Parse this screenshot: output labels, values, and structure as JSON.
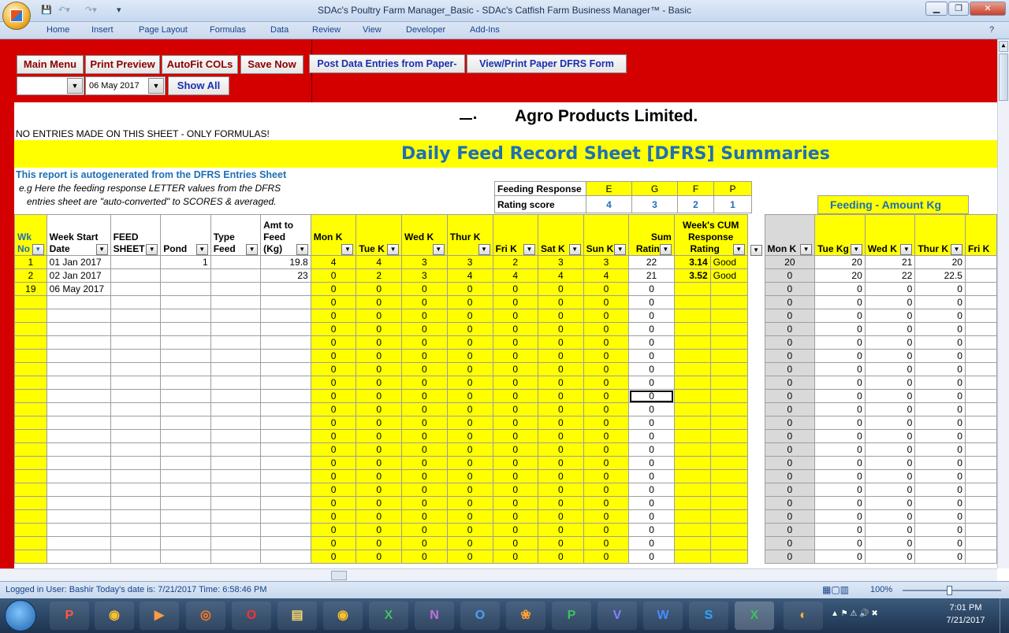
{
  "window": {
    "title": "SDAc's Poultry Farm Manager_Basic - SDAc's Catfish Farm Business Manager™ - Basic"
  },
  "ribbon_tabs": [
    "Home",
    "Insert",
    "Page Layout",
    "Formulas",
    "Data",
    "Review",
    "View",
    "Developer",
    "Add-Ins"
  ],
  "buttons": {
    "main_menu": "Main Menu",
    "print_preview": "Print Preview",
    "autofit": "AutoFit COLs",
    "save_now": "Save Now",
    "post_data": "Post Data Entries from Paper-",
    "view_print": "View/Print Paper DFRS Form",
    "show_all": "Show All"
  },
  "date_combo": {
    "value": "06 May 2017"
  },
  "company": "Agro Products Limited.",
  "notice": "NO ENTRIES MADE ON THIS SHEET - ONLY FORMULAS!",
  "sheet_title": "Daily Feed Record Sheet [DFRS] Summaries",
  "report_note": {
    "line1": "This report is autogenerated from the DFRS Entries Sheet",
    "line2": "e.g Here the feeding response LETTER values from the DFRS",
    "line3": "entries sheet are \"auto-converted\" to SCORES & averaged."
  },
  "response_legend": {
    "feeding_label": "Feeding Response",
    "rating_label": "Rating score",
    "letters": [
      "E",
      "G",
      "F",
      "P"
    ],
    "scores": [
      "4",
      "3",
      "2",
      "1"
    ]
  },
  "amount_title": "Feeding - Amount Kg",
  "headers": {
    "wk_no": [
      "Wk",
      "No"
    ],
    "week_start": [
      "Week Start",
      "Date"
    ],
    "feed_sheet": [
      "FEED",
      "SHEET"
    ],
    "pond": "Pond",
    "type_feed": [
      "Type",
      "Feed"
    ],
    "amt_feed": [
      "Amt to",
      "Feed",
      "(Kg)"
    ],
    "days": [
      "Mon K",
      "Tue K",
      "Wed K",
      "Thur K",
      "Fri K",
      "Sat K",
      "Sun K"
    ],
    "sum_rating": [
      "Sum",
      "Ratin"
    ],
    "cum": [
      "Week's CUM",
      "Response",
      "Rating"
    ],
    "amount_days": [
      "Mon K",
      "Tue Kg",
      "Wed K",
      "Thur K",
      "Fri K"
    ]
  },
  "rows": [
    {
      "wk": "1",
      "date": "01 Jan 2017",
      "pond": "1",
      "amt": "19.8",
      "days": [
        "4",
        "4",
        "3",
        "3",
        "2",
        "3",
        "3"
      ],
      "sum": "22",
      "cum": "3.14",
      "rating": "Good",
      "kg": [
        "20",
        "20",
        "21",
        "20"
      ]
    },
    {
      "wk": "2",
      "date": "02 Jan 2017",
      "pond": "",
      "amt": "23",
      "days": [
        "0",
        "2",
        "3",
        "4",
        "4",
        "4",
        "4"
      ],
      "sum": "21",
      "cum": "3.52",
      "rating": "Good",
      "kg": [
        "0",
        "20",
        "22",
        "22.5"
      ]
    },
    {
      "wk": "19",
      "date": "06 May 2017",
      "pond": "",
      "amt": "",
      "days": [
        "0",
        "0",
        "0",
        "0",
        "0",
        "0",
        "0"
      ],
      "sum": "0",
      "cum": "",
      "rating": "",
      "kg": [
        "0",
        "0",
        "0",
        "0"
      ]
    }
  ],
  "zero_rows": 20,
  "status": {
    "text": "Logged in User: Bashir        Today's date is: 7/21/2017 Time: 6:58:46 PM",
    "zoom": "100%"
  },
  "clock": {
    "time": "7:01 PM",
    "date": "7/21/2017"
  },
  "colors": {
    "red": "#d40000",
    "yellow": "#ffff00",
    "blue_title": "#1f6fb5"
  }
}
